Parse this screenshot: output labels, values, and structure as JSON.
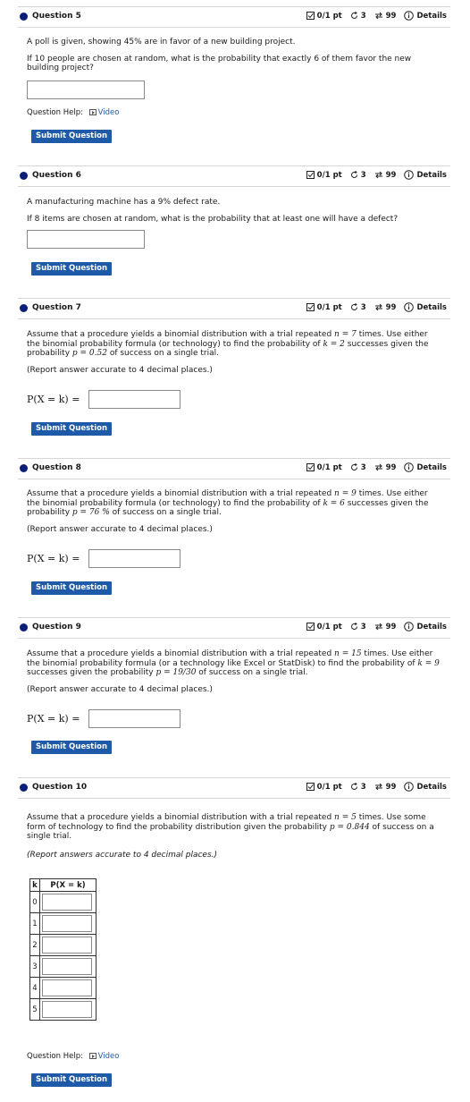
{
  "meta_common": {
    "score": "0/1 pt",
    "retries": "3",
    "attempts": "99",
    "details": "Details"
  },
  "questions": [
    {
      "title": "Question 5",
      "lines": [
        "A poll is given, showing 45% are in favor of a new building project.",
        "If 10 people are chosen at random, what is the probability that exactly 6 of them favor the new building project?"
      ],
      "help_label": "Question Help:",
      "help_link": "Video",
      "submit": "Submit Question"
    },
    {
      "title": "Question 6",
      "lines": [
        "A manufacturing machine has a 9% defect rate.",
        "If 8 items are chosen at random, what is the probability that at least one will have a defect?"
      ],
      "submit": "Submit Question"
    },
    {
      "title": "Question 7",
      "text_a": "Assume that a procedure yields a binomial distribution with a trial repeated ",
      "n_expr": "n = 7",
      "text_b": " times. Use either the binomial probability formula (or technology) to find the probability of ",
      "k_expr": "k = 2",
      "text_c": " successes given the probability ",
      "p_expr": "p = 0.52",
      "text_d": " of success on a single trial.",
      "report": "(Report answer accurate to 4 decimal places.)",
      "lhs": "P(X = k) =",
      "submit": "Submit Question"
    },
    {
      "title": "Question 8",
      "text_a": "Assume that a procedure yields a binomial distribution with a trial repeated ",
      "n_expr": "n = 9",
      "text_b": " times. Use either the binomial probability formula (or technology) to find the probability of ",
      "k_expr": "k = 6",
      "text_c": " successes given the probability ",
      "p_expr": "p = 76 %",
      "text_d": " of success on a single trial.",
      "report": "(Report answer accurate to 4 decimal places.)",
      "lhs": "P(X = k) =",
      "submit": "Submit Question"
    },
    {
      "title": "Question 9",
      "text_a": "Assume that a procedure yields a binomial distribution with a trial repeated ",
      "n_expr": "n = 15",
      "text_b": " times. Use either the binomial probability formula (or a technology like Excel or StatDisk) to find the probability of ",
      "k_expr": "k = 9",
      "text_c": " successes given the probability ",
      "p_expr": "p = 19/30",
      "text_d": " of success on a single trial.",
      "report": "(Report answer accurate to 4 decimal places.)",
      "lhs": "P(X = k) =",
      "submit": "Submit Question"
    },
    {
      "title": "Question 10",
      "text_a": "Assume that a procedure yields a binomial distribution with a trial repeated ",
      "n_expr": "n = 5",
      "text_b": " times. Use some form of technology to find the probability distribution given the probability ",
      "p_expr": "p = 0.844",
      "text_d": " of success on a single trial.",
      "report": "(Report answers accurate to 4 decimal places.)",
      "col_k": "k",
      "col_p": "P(X = k)",
      "rows": [
        "0",
        "1",
        "2",
        "3",
        "4",
        "5"
      ],
      "help_label": "Question Help:",
      "help_link": "Video",
      "submit": "Submit Question"
    }
  ]
}
